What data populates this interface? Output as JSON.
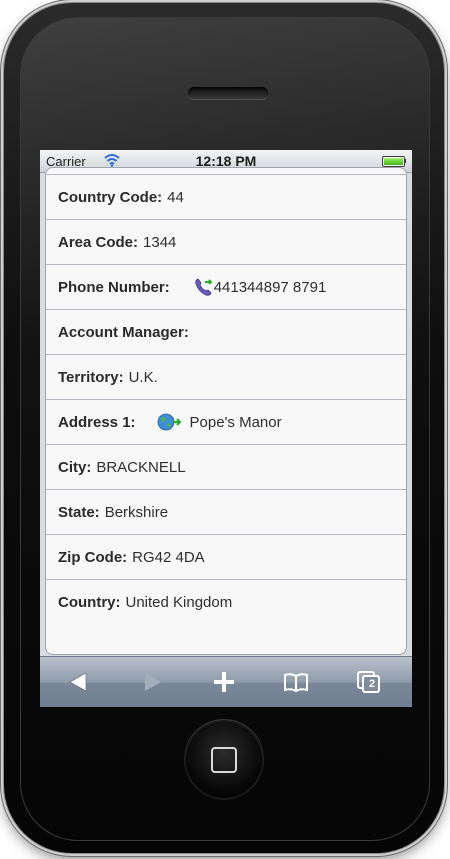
{
  "status_bar": {
    "carrier": "Carrier",
    "time": "12:18 PM",
    "wifi_icon": "wifi-icon",
    "battery_icon": "battery-full-icon"
  },
  "details": [
    {
      "label": "Country Code:",
      "value": "44"
    },
    {
      "label": "Area Code:",
      "value": "1344"
    },
    {
      "label": "Phone Number:",
      "value": "441344897 8791",
      "icon": "phone-call-icon"
    },
    {
      "label": "Account Manager:",
      "value": ""
    },
    {
      "label": "Territory:",
      "value": "U.K."
    },
    {
      "label": "Address 1:",
      "value": "Pope's Manor",
      "icon": "globe-map-icon"
    },
    {
      "label": "City:",
      "value": "BRACKNELL"
    },
    {
      "label": "State:",
      "value": "Berkshire"
    },
    {
      "label": "Zip Code:",
      "value": "RG42 4DA"
    },
    {
      "label": "Country:",
      "value": "United Kingdom"
    }
  ],
  "toolbar": {
    "back": "back-arrow-icon",
    "forward": "forward-arrow-icon",
    "add": "plus-icon",
    "bookmarks": "open-book-icon",
    "pages": "pages-icon",
    "pages_count": "2"
  },
  "colors": {
    "toolbar": "#8e9bab",
    "row_background": "#f8f8f8",
    "separator": "#b6bac0",
    "battery": "#44b612"
  }
}
